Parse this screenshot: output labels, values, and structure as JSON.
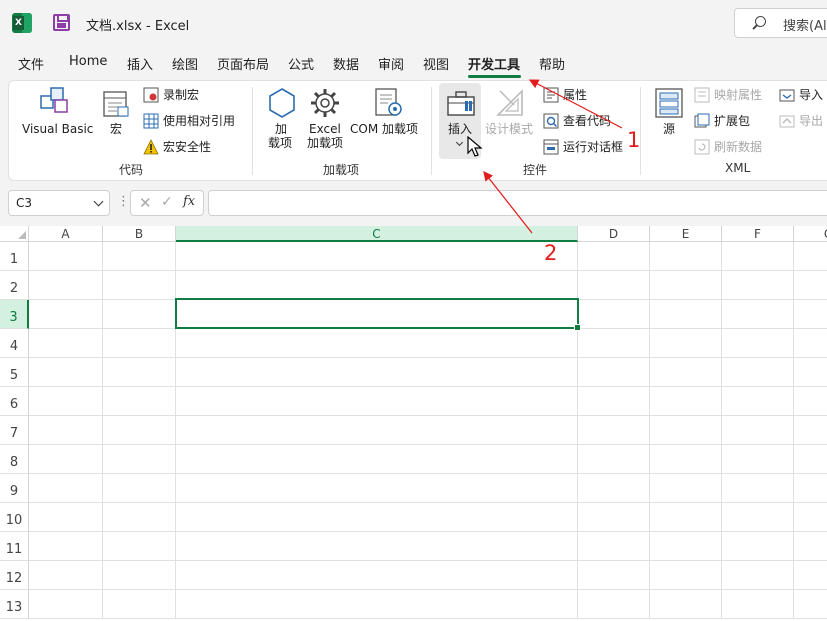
{
  "window": {
    "title": "文档.xlsx  -  Excel",
    "search_placeholder": "搜索(Alt"
  },
  "tabs": [
    {
      "label": "文件"
    },
    {
      "label": "Home"
    },
    {
      "label": "插入"
    },
    {
      "label": "绘图"
    },
    {
      "label": "页面布局"
    },
    {
      "label": "公式"
    },
    {
      "label": "数据"
    },
    {
      "label": "审阅"
    },
    {
      "label": "视图"
    },
    {
      "label": "开发工具",
      "active": true
    },
    {
      "label": "帮助"
    }
  ],
  "ribbon": {
    "code": {
      "group_name": "代码",
      "visual_basic": "Visual Basic",
      "macros": "宏",
      "record_macro": "录制宏",
      "relative_ref": "使用相对引用",
      "macro_security": "宏安全性"
    },
    "addins": {
      "group_name": "加载项",
      "addins_line1": "加",
      "addins_line2": "载项",
      "excel_addins_line1": "Excel",
      "excel_addins_line2": "加载项",
      "com_addins": "COM 加载项"
    },
    "controls": {
      "group_name": "控件",
      "insert": "插入",
      "design_mode": "设计模式",
      "properties": "属性",
      "view_code": "查看代码",
      "run_dialog": "运行对话框"
    },
    "xml": {
      "group_name": "XML",
      "source": "源",
      "map_properties": "映射属性",
      "expansion_packs": "扩展包",
      "refresh_data": "刷新数据",
      "import": "导入",
      "export": "导出"
    }
  },
  "formula_bar": {
    "name_box": "C3",
    "fx": "fx",
    "formula": ""
  },
  "grid": {
    "columns": [
      "A",
      "B",
      "C",
      "D",
      "E",
      "F",
      "G"
    ],
    "rows": [
      "1",
      "2",
      "3",
      "4",
      "5",
      "6",
      "7",
      "8",
      "9",
      "10",
      "11",
      "12",
      "13"
    ],
    "active_cell": "C3"
  },
  "annotations": {
    "marker1": "1",
    "marker2": "2",
    "arrow_color": "#e31b1b"
  },
  "colors": {
    "accent": "#107c41",
    "selection_header": "#d3f0e0"
  }
}
